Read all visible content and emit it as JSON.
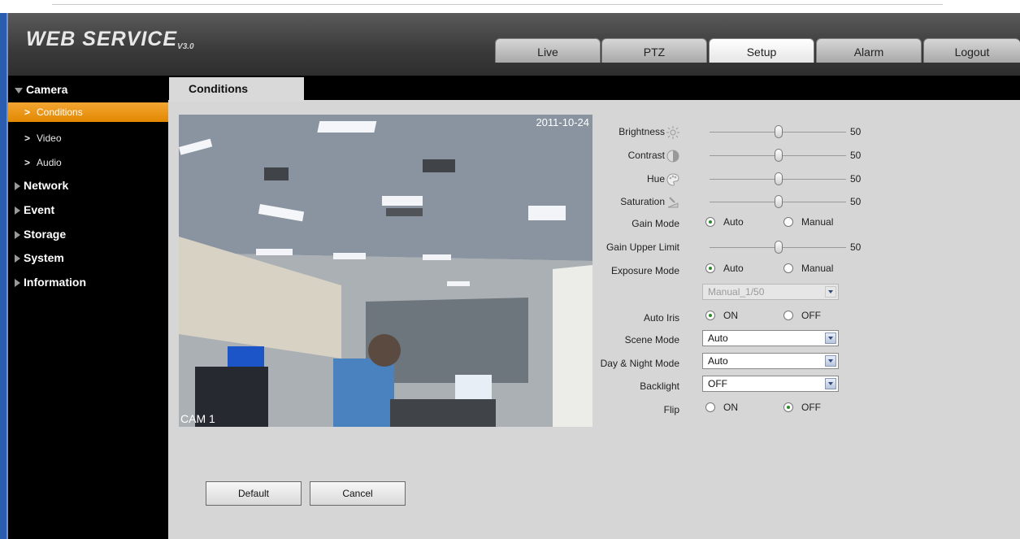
{
  "app": {
    "logo_main": "WEB  SERVICE",
    "logo_version": "V3.0"
  },
  "tabs": [
    {
      "label": "Live",
      "active": false
    },
    {
      "label": "PTZ",
      "active": false
    },
    {
      "label": "Setup",
      "active": true
    },
    {
      "label": "Alarm",
      "active": false
    },
    {
      "label": "Logout",
      "active": false
    }
  ],
  "nav": {
    "camera": "Camera",
    "conditions": "Conditions",
    "video": "Video",
    "audio": "Audio",
    "network": "Network",
    "event": "Event",
    "storage": "Storage",
    "system": "System",
    "information": "Information"
  },
  "content_tab": "Conditions",
  "camera": {
    "timestamp": "2011-10-24",
    "label": "CAM 1"
  },
  "settings": {
    "brightness_label": "Brightness",
    "brightness_value": "50",
    "contrast_label": "Contrast",
    "contrast_value": "50",
    "hue_label": "Hue",
    "hue_value": "50",
    "saturation_label": "Saturation",
    "saturation_value": "50",
    "gain_mode_label": "Gain Mode",
    "gain_mode_auto": "Auto",
    "gain_mode_manual": "Manual",
    "gain_upper_label": "Gain Upper Limit",
    "gain_upper_value": "50",
    "exposure_mode_label": "Exposure Mode",
    "exposure_auto": "Auto",
    "exposure_manual": "Manual",
    "exposure_select": "Manual_1/50",
    "auto_iris_label": "Auto Iris",
    "iris_on": "ON",
    "iris_off": "OFF",
    "scene_mode_label": "Scene Mode",
    "scene_mode_value": "Auto",
    "day_night_label": "Day & Night Mode",
    "day_night_value": "Auto",
    "backlight_label": "Backlight",
    "backlight_value": "OFF",
    "flip_label": "Flip",
    "flip_on": "ON",
    "flip_off": "OFF"
  },
  "buttons": {
    "default": "Default",
    "cancel": "Cancel"
  },
  "colors": {
    "accent_orange": "#e38800",
    "frame_blue": "#2a5db0"
  }
}
